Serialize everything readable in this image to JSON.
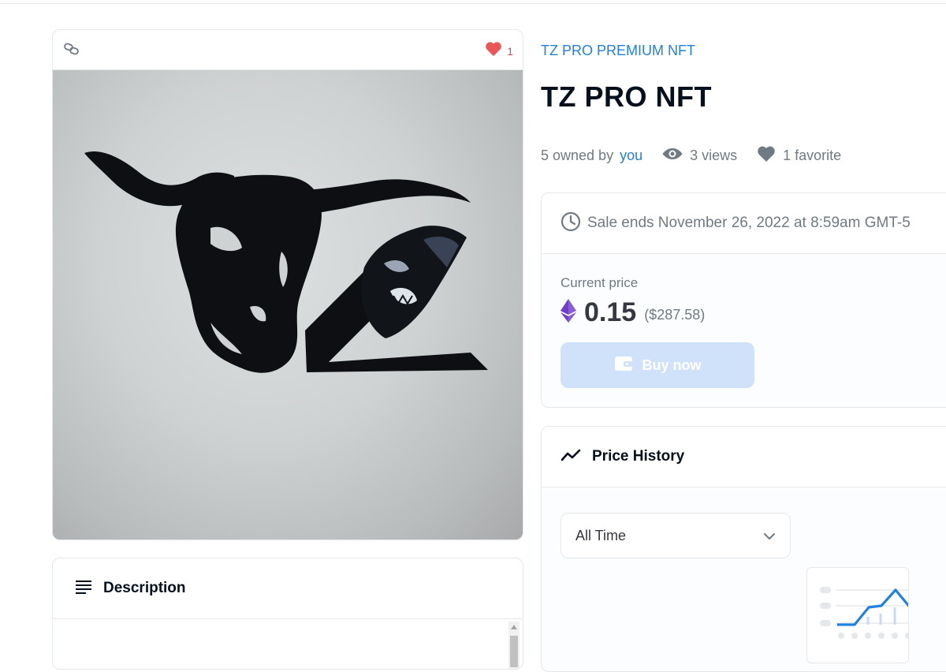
{
  "media": {
    "favorites_count": "1",
    "icons": {
      "chain": "chain-link-icon",
      "heart": "heart-icon"
    },
    "heart_color": "#eb5757"
  },
  "description": {
    "title": "Description",
    "icon": "list-lines-icon"
  },
  "collection": {
    "name": "TZ PRO PREMIUM NFT",
    "color": "#2081e2"
  },
  "title": "TZ PRO NFT",
  "stats": {
    "owned_prefix": "5 owned by",
    "owner": "you",
    "views": "3 views",
    "favorites": "1 favorite",
    "icons": {
      "views": "eye-icon",
      "favorites": "heart-icon"
    }
  },
  "sale": {
    "ends_text": "Sale ends November 26, 2022 at 8:59am GMT-5",
    "current_price_label": "Current price",
    "price": "0.15",
    "price_usd": "($287.58)",
    "currency_icon": "ethereum-icon",
    "buy_label": "Buy now",
    "buy_icon": "wallet-icon",
    "buy_color": "#cfe2f9"
  },
  "price_history": {
    "title": "Price History",
    "icon": "trend-line-icon",
    "filter_selected": "All Time",
    "empty_chart_icon": "empty-chart-icon"
  }
}
